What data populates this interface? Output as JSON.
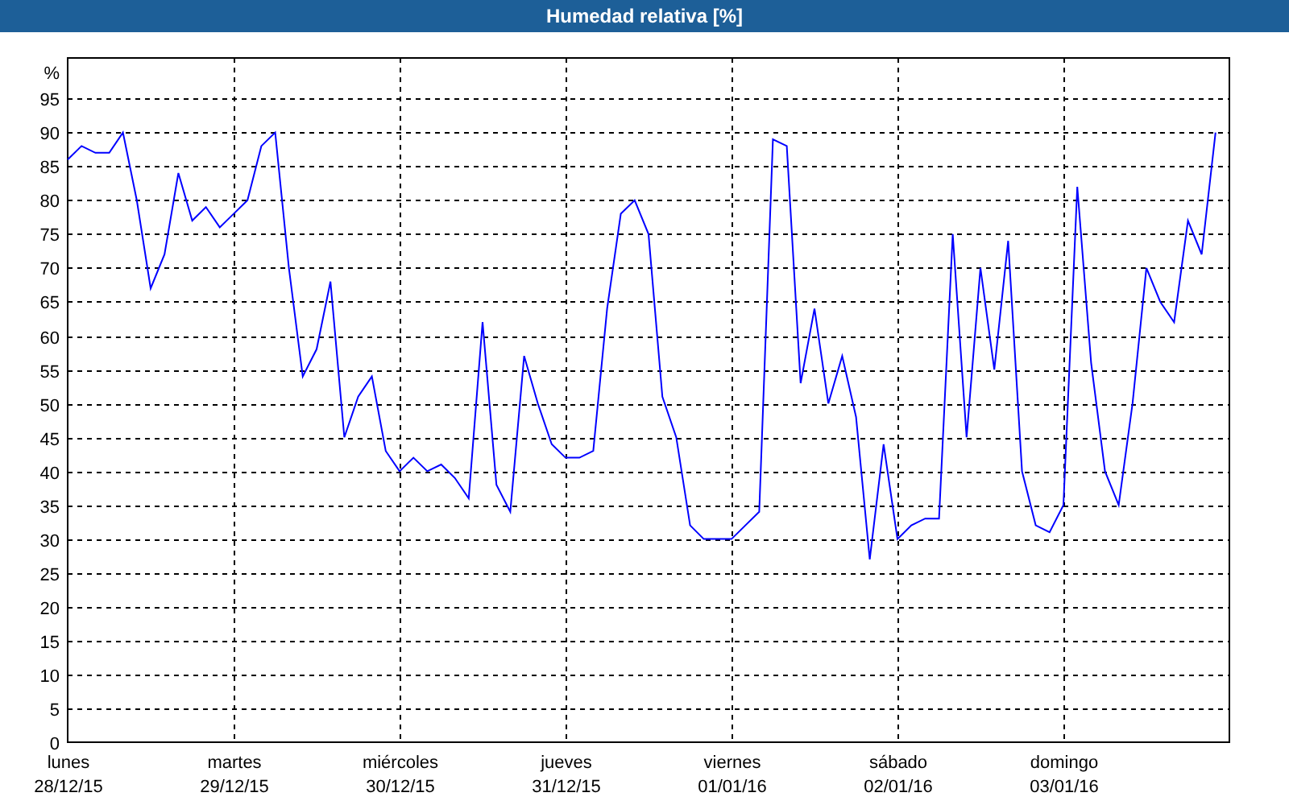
{
  "window": {
    "title": "Humedad relativa [%]"
  },
  "chart": {
    "chart_data": {
      "type": "line",
      "grid": true,
      "ylabel": "%",
      "ylim": [
        0,
        101
      ],
      "yticks": [
        0,
        5,
        10,
        15,
        20,
        25,
        30,
        35,
        40,
        45,
        50,
        55,
        60,
        65,
        70,
        75,
        80,
        85,
        90,
        95
      ],
      "categories": [
        "lunes\n28/12/15",
        null,
        null,
        null,
        null,
        null,
        null,
        null,
        null,
        null,
        null,
        null,
        "martes\n29/12/15",
        null,
        null,
        null,
        null,
        null,
        null,
        null,
        null,
        null,
        null,
        null,
        "miércoles\n30/12/15",
        null,
        null,
        null,
        null,
        null,
        null,
        null,
        null,
        null,
        null,
        null,
        "jueves\n31/12/15",
        null,
        null,
        null,
        null,
        null,
        null,
        null,
        null,
        null,
        null,
        null,
        "viernes\n01/01/16",
        null,
        null,
        null,
        null,
        null,
        null,
        null,
        null,
        null,
        null,
        null,
        "sábado\n02/01/16",
        null,
        null,
        null,
        null,
        null,
        null,
        null,
        null,
        null,
        null,
        null,
        "domingo\n03/01/16",
        null,
        null,
        null,
        null,
        null,
        null,
        null,
        null,
        null,
        null,
        null,
        null
      ],
      "series": [
        {
          "color": "#0000ff",
          "values": [
            86,
            88,
            87,
            87,
            90,
            80,
            67,
            72,
            84,
            77,
            79,
            76,
            78,
            80,
            88,
            90,
            70,
            54,
            58,
            68,
            45,
            51,
            54,
            43,
            40,
            42,
            40,
            41,
            39,
            36,
            62,
            38,
            34,
            57,
            50,
            44,
            42,
            42,
            43,
            64,
            78,
            80,
            75,
            51,
            45,
            32,
            30,
            30,
            30,
            32,
            34,
            89,
            88,
            53,
            64,
            50,
            57,
            48,
            27,
            44,
            30,
            32,
            33,
            33,
            75,
            45,
            70,
            55,
            74,
            40,
            32,
            31,
            35,
            82,
            56,
            40,
            35,
            50,
            70,
            65,
            62,
            77,
            72,
            90,
            null
          ]
        }
      ]
    }
  }
}
